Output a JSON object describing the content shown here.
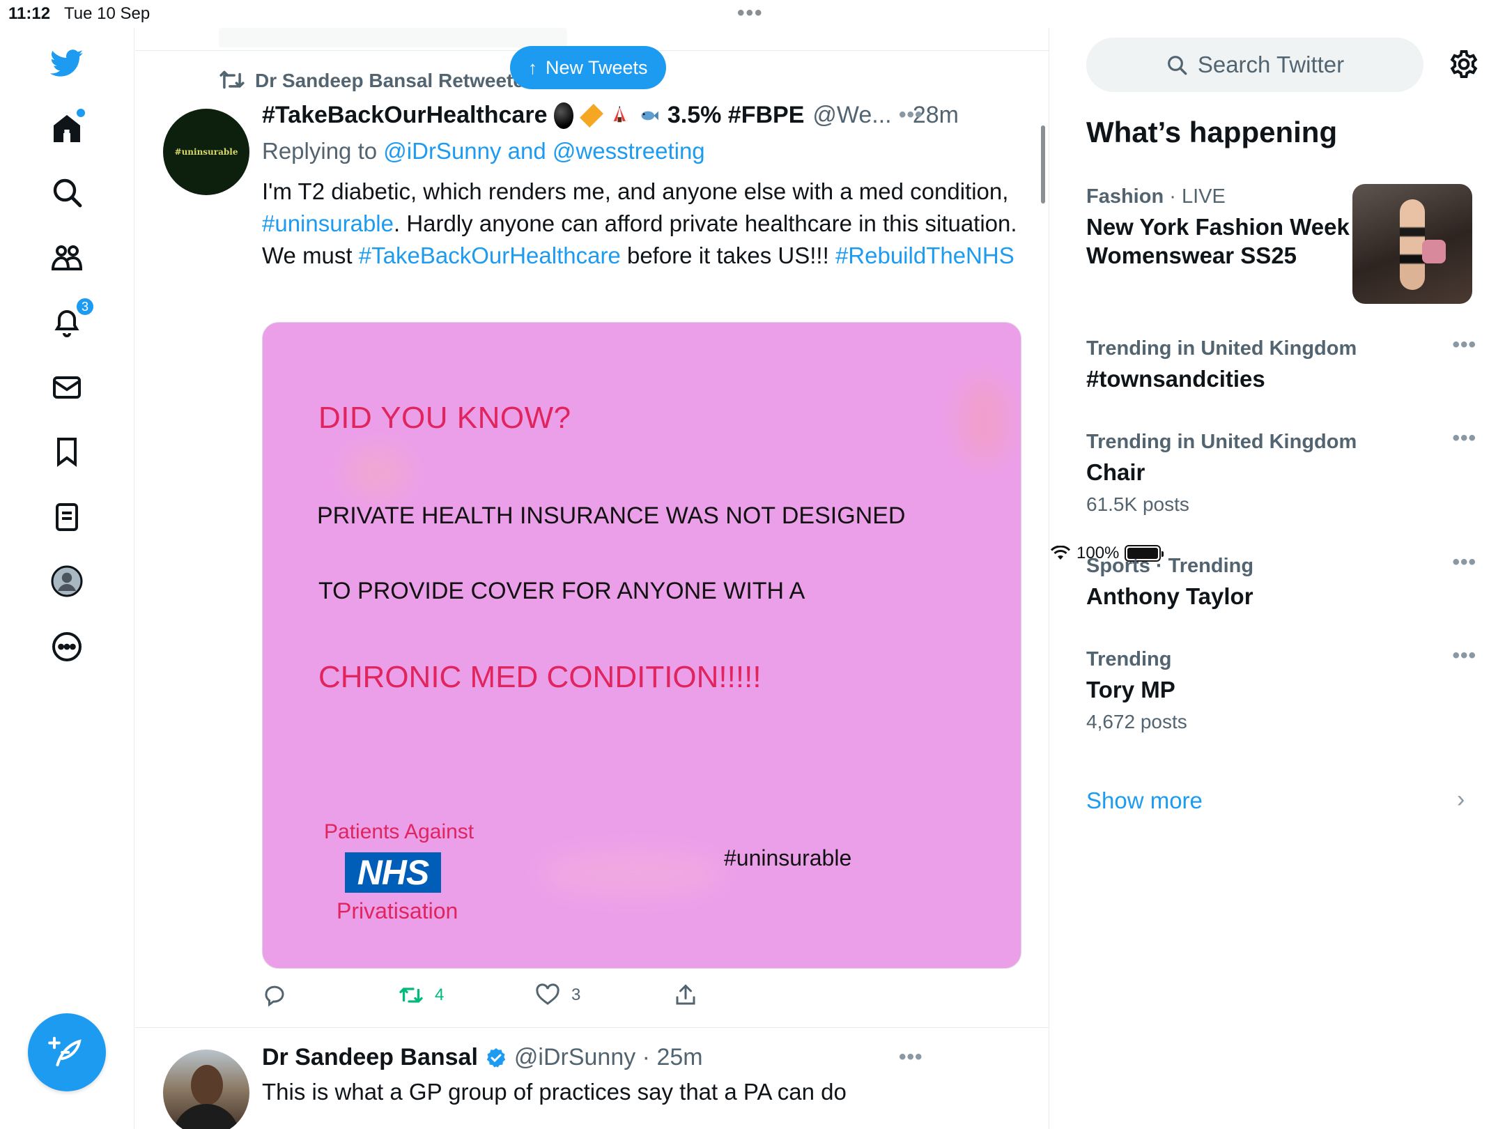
{
  "status_bar": {
    "time": "11:12",
    "date": "Tue 10 Sep",
    "battery": "100%"
  },
  "nav": {
    "notifications_badge": "3",
    "items": [
      "twitter-logo",
      "home-icon",
      "search-icon",
      "communities-icon",
      "notifications-icon",
      "messages-icon",
      "bookmarks-icon",
      "lists-icon",
      "profile-icon",
      "more-icon"
    ]
  },
  "timeline": {
    "new_tweets": "New Tweets",
    "retweet_by": "Dr Sandeep Bansal Retweeted",
    "tweet1": {
      "avatar_text": "#uninsurable",
      "name": "#TakeBackOurHealthcare",
      "stat": "3.5% #FBPE",
      "handle_time": "@We... · 28m",
      "replying_prefix": "Replying to",
      "replying_to": "@iDrSunny and @wesstreeting",
      "text_1": "I'm T2 diabetic, which renders me, and anyone else with a med condition, ",
      "text_link_1": "#uninsurable",
      "text_2": ". Hardly anyone can afford private healthcare in this situation. We must ",
      "text_link_2": "#TakeBackOurHealthcare",
      "text_3": " before it takes US!!! ",
      "text_link_3": "#RebuildTheNHS",
      "media": {
        "title": "DID YOU KNOW?",
        "line1": "PRIVATE HEALTH INSURANCE WAS NOT DESIGNED",
        "line2": "TO PROVIDE COVER FOR ANYONE WITH A",
        "line3": "CHRONIC MED CONDITION!!!!!",
        "org_top": "Patients Against",
        "org_logo": "NHS",
        "org_bottom": "Privatisation",
        "hashtag": "#uninsurable"
      },
      "retweets": "4",
      "likes": "3"
    },
    "tweet2": {
      "name": "Dr Sandeep Bansal",
      "handle_time": "@iDrSunny · 25m",
      "text": "This is what a GP group of practices say that a PA can do"
    }
  },
  "sidebar": {
    "search_placeholder": "Search Twitter",
    "heading": "What’s happening",
    "trends": [
      {
        "category": "Fashion",
        "context": " · LIVE",
        "title": "New York Fashion Week Womenswear SS25",
        "posts": ""
      },
      {
        "category": "Trending in United Kingdom",
        "context": "",
        "title": "#townsandcities",
        "posts": ""
      },
      {
        "category": "Trending in United Kingdom",
        "context": "",
        "title": "Chair",
        "posts": "61.5K posts"
      },
      {
        "category": "Sports · Trending",
        "context": "",
        "title": "Anthony Taylor",
        "posts": ""
      },
      {
        "category": "Trending",
        "context": "",
        "title": "Tory MP",
        "posts": "4,672 posts"
      }
    ],
    "show_more": "Show more"
  },
  "colors": {
    "accent": "#1d9bf0",
    "retweet_green": "#00ba7c",
    "media_background": "#ec9fe9",
    "media_red": "#e0245e",
    "nhs_blue": "#005eb8"
  }
}
